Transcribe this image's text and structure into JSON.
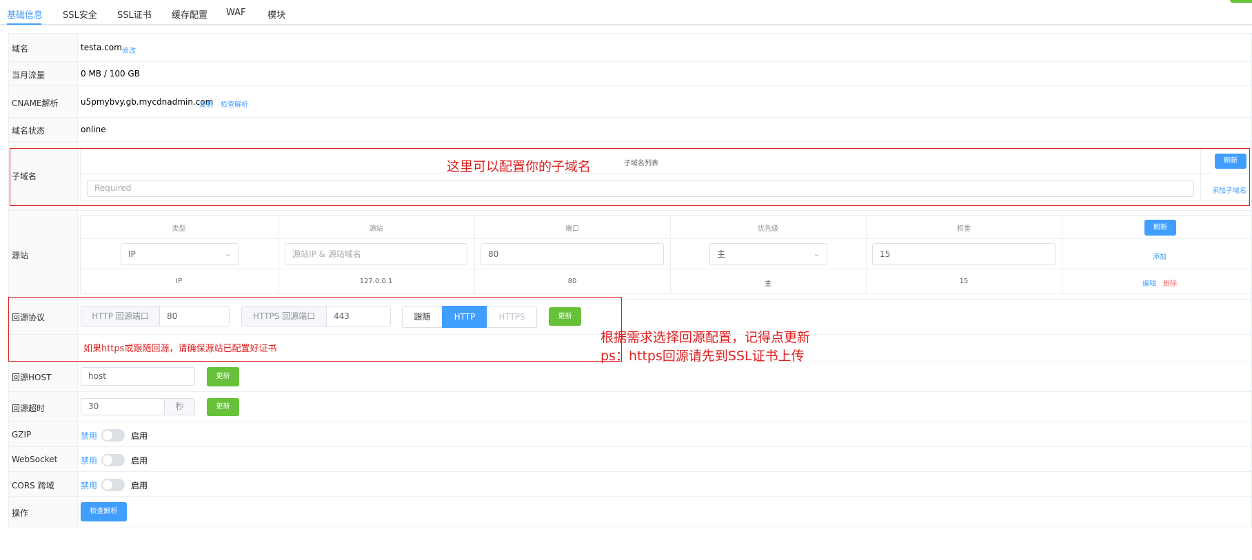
{
  "tabs": [
    "基础信息",
    "SSL安全",
    "SSL证书",
    "缓存配置",
    "WAF",
    "模块"
  ],
  "rows": {
    "domain": {
      "label": "域名",
      "value": "testa.com",
      "action": "修改"
    },
    "traffic": {
      "label": "当月流量",
      "value": "0 MB / 100 GB"
    },
    "cname": {
      "label": "CNAME解析",
      "value": "u5pmybvy.gb.mycdnadmin.com",
      "copy": "复制",
      "check": "检查解析"
    },
    "status": {
      "label": "域名状态",
      "value": "online"
    },
    "subdomain": {
      "label": "子域名",
      "list_header": "子域名列表",
      "refresh": "刷新",
      "placeholder": "Required",
      "add": "添加子域名"
    },
    "origin": {
      "label": "源站",
      "columns": [
        "类型",
        "源站",
        "端口",
        "优先级",
        "权重"
      ],
      "refresh": "刷新",
      "form": {
        "type": "IP",
        "origin_placeholder": "源站IP & 源站域名",
        "port": "80",
        "priority": "主",
        "weight": "15",
        "add": "添加"
      },
      "entries": [
        {
          "type": "IP",
          "origin": "127.0.0.1",
          "port": "80",
          "priority": "主",
          "weight": "15",
          "edit": "编辑",
          "delete": "删除"
        }
      ]
    },
    "protocol": {
      "label": "回源协议",
      "http_port_label": "HTTP 回源端口",
      "http_port": "80",
      "https_port_label": "HTTPS 回源端口",
      "https_port": "443",
      "options": [
        "跟随",
        "HTTP",
        "HTTPS"
      ],
      "selected": "HTTP",
      "update": "更新",
      "warning": "如果https或跟随回源，请确保源站已配置好证书"
    },
    "host": {
      "label": "回源HOST",
      "value": "host",
      "update": "更新"
    },
    "timeout": {
      "label": "回源超时",
      "value": "30",
      "unit": "秒",
      "update": "更新"
    },
    "gzip": {
      "label": "GZIP",
      "off": "禁用",
      "on": "启用",
      "enabled": false
    },
    "websocket": {
      "label": "WebSocket",
      "off": "禁用",
      "on": "启用",
      "enabled": false
    },
    "cors": {
      "label": "CORS 跨域",
      "off": "禁用",
      "on": "启用",
      "enabled": false
    },
    "ops": {
      "label": "操作",
      "button": "检查解析"
    }
  },
  "annotations": {
    "subdomain_note": "这里可以配置你的子域名",
    "protocol_note_line1": "根据需求选择回源配置，记得点更新",
    "protocol_note_line2": "ps：https回源请先到SSL证书上传"
  },
  "colors": {
    "primary": "#409eff",
    "success": "#67c23a",
    "danger": "#f56c6c",
    "annotation": "#e02020"
  }
}
